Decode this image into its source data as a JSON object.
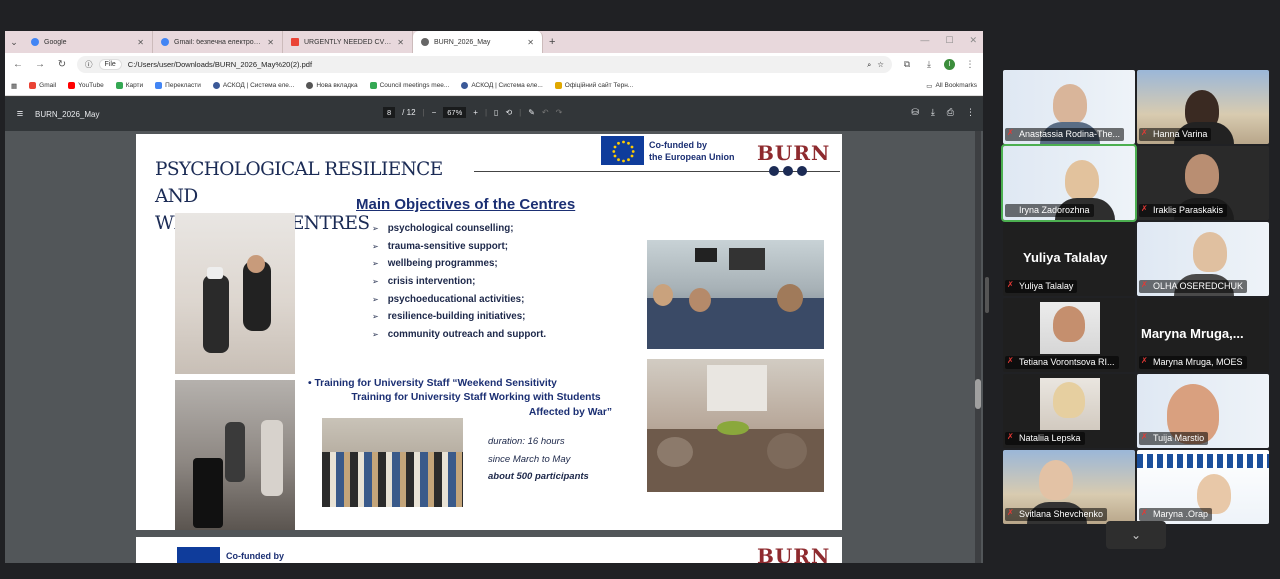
{
  "browser": {
    "tabs": [
      {
        "label": "Google",
        "color": "#4285f4",
        "active": false
      },
      {
        "label": "Gmail: безпечна електронна пош",
        "color": "#4285f4",
        "active": false
      },
      {
        "label": "URGENTLY NEEDED CVs FOR CUR",
        "color": "#ea4335",
        "active": false
      },
      {
        "label": "BURN_2026_May",
        "color": "#666666",
        "active": true
      }
    ],
    "new_tab": "+",
    "address": {
      "chip": "File",
      "url": "C:/Users/user/Downloads/BURN_2026_May%20(2).pdf"
    },
    "avatar_letter": "I",
    "bookmarks": [
      {
        "label": "Gmail",
        "color": "#ea4335"
      },
      {
        "label": "YouTube",
        "color": "#ff0000"
      },
      {
        "label": "Карти",
        "color": "#34a853"
      },
      {
        "label": "Перекласти",
        "color": "#4285f4"
      },
      {
        "label": "АСКОД | Система еле...",
        "color": "#3b5998"
      },
      {
        "label": "Нова вкладка",
        "color": "#555555"
      },
      {
        "label": "Council meetings mee...",
        "color": "#34a853"
      },
      {
        "label": "АСКОД | Система еле...",
        "color": "#3b5998"
      },
      {
        "label": "Офіційний сайт Терн...",
        "color": "#e0a800"
      }
    ],
    "all_bookmarks": "All Bookmarks"
  },
  "pdf": {
    "filename": "BURN_2026_May",
    "page_current": "8",
    "page_total": "/ 12",
    "zoom": "67%"
  },
  "slide": {
    "title_line1": "PSYCHOLOGICAL RESILIENCE AND",
    "title_line2": "WELLBEING CENTRES",
    "eu_line1": "Co-funded by",
    "eu_line2": "the European Union",
    "burn_logo": "BURN",
    "objectives_title": "Main Objectives of the Centres",
    "objectives": [
      "psychological counselling;",
      "trauma-sensitive support;",
      "wellbeing programmes;",
      "crisis intervention;",
      "psychoeducational activities;",
      "resilience-building initiatives;",
      "community outreach and support."
    ],
    "training_line1": "• Training for University Staff “Weekend Sensitivity",
    "training_line2": "Training for University Staff Working with Students",
    "training_line3": "Affected by War”",
    "duration": "duration: 16 hours",
    "since": "since March to May",
    "participants": "about 500 participants"
  },
  "slide_next": {
    "eu_line1": "Co-funded by",
    "burn_logo": "BURN"
  },
  "participants": [
    {
      "name": "Anastassia Rodina-The..."
    },
    {
      "name": "Hanna Varina"
    },
    {
      "name": "Iryna Zadorozhna"
    },
    {
      "name": "Iraklis Paraskakis"
    },
    {
      "name": "Yuliya Talalay",
      "bigname": "Yuliya Talalay"
    },
    {
      "name": "OLHA OSEREDCHUK"
    },
    {
      "name": "Tetiana Vorontsova RI..."
    },
    {
      "name": "Maryna Mruga, MOES",
      "bigname": "Maryna Mruga,..."
    },
    {
      "name": "Nataliia Lepska"
    },
    {
      "name": "Tuija Marstio"
    },
    {
      "name": "Svitlana Shevchenko"
    },
    {
      "name": "Maryna .Orap"
    }
  ],
  "colors": {
    "speaking_border": "#4caf50",
    "mic_muted": "#e53935",
    "slide_navy": "#1b2f73",
    "burn_red": "#8e2a2e"
  }
}
